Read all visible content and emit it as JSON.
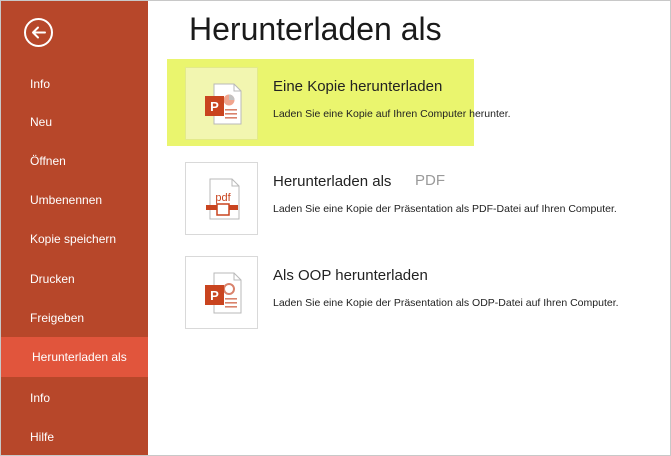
{
  "sidebar": {
    "items": [
      {
        "label": "Info"
      },
      {
        "label": "Neu"
      },
      {
        "label": "Öffnen"
      },
      {
        "label": "Umbenennen"
      },
      {
        "label": "Kopie speichern"
      },
      {
        "label": "Drucken"
      },
      {
        "label": "Freigeben"
      },
      {
        "label": "Herunterladen als"
      },
      {
        "label": "Info"
      },
      {
        "label": "Hilfe"
      }
    ]
  },
  "main": {
    "title": "Herunterladen als",
    "options": [
      {
        "title": "Eine Kopie herunterladen",
        "description": "Laden Sie eine Kopie auf Ihren Computer herunter.",
        "icon": "powerpoint-file-icon"
      },
      {
        "title": "Herunterladen als",
        "ghost_text": "PDF",
        "description": "Laden Sie eine Kopie der Präsentation als PDF-Datei auf Ihren Computer.",
        "icon": "pdf-file-icon",
        "icon_text": "pdf"
      },
      {
        "title": "Als OOP herunterladen",
        "description": "Laden Sie eine Kopie der Präsentation als ODP-Datei auf Ihren Computer.",
        "icon": "odp-file-icon"
      }
    ]
  },
  "colors": {
    "sidebar": "#b7472a",
    "active_item": "#e1553c",
    "highlight": "#eaf56e"
  }
}
